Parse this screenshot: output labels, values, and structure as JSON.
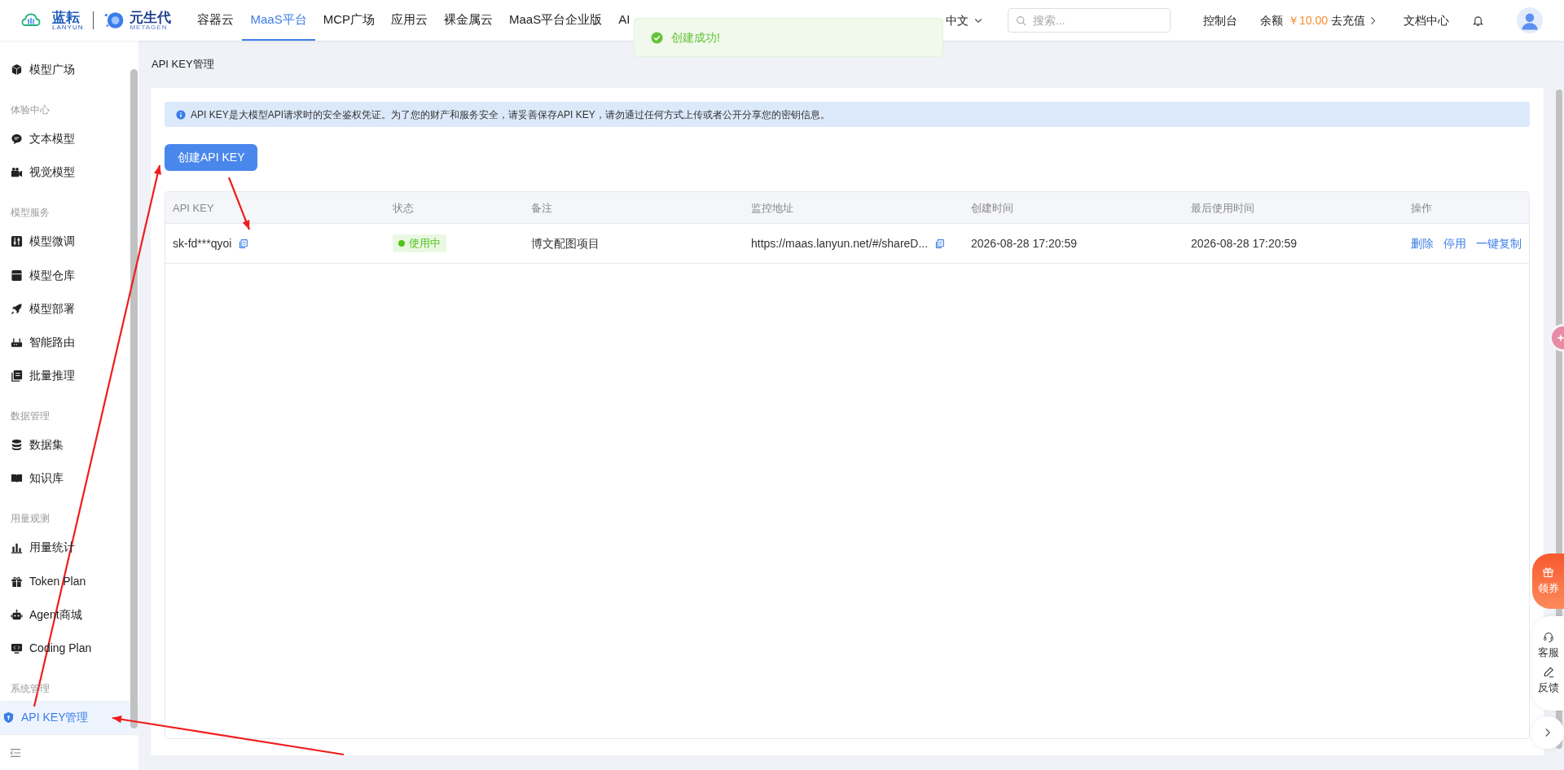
{
  "header": {
    "logo_brand": "蓝耘",
    "logo_sub": "LANYUN",
    "logo2_brand": "元生代",
    "logo2_sub": "METAGEN",
    "nav": [
      {
        "label": "容器云",
        "selected": false
      },
      {
        "label": "MaaS平台",
        "selected": true
      },
      {
        "label": "MCP广场",
        "selected": false
      },
      {
        "label": "应用云",
        "selected": false
      },
      {
        "label": "裸金属云",
        "selected": false
      },
      {
        "label": "MaaS平台企业版",
        "selected": false
      },
      {
        "label": "AI",
        "selected": false
      }
    ],
    "language": "中文",
    "search": {
      "placeholder": "搜索..."
    },
    "console": "控制台",
    "balance_label": "余额",
    "balance": "￥10.00",
    "recharge": "去充值",
    "docs": "文档中心"
  },
  "toast": {
    "message": "创建成功!"
  },
  "sidebar": {
    "groups": [
      {
        "items": [
          {
            "label": "模型广场",
            "selected": false
          }
        ]
      },
      {
        "title": "体验中心",
        "items": [
          {
            "label": "文本模型",
            "selected": false
          },
          {
            "label": "视觉模型",
            "selected": false
          }
        ]
      },
      {
        "title": "模型服务",
        "items": [
          {
            "label": "模型微调",
            "selected": false
          },
          {
            "label": "模型仓库",
            "selected": false
          },
          {
            "label": "模型部署",
            "selected": false
          },
          {
            "label": "智能路由",
            "selected": false
          },
          {
            "label": "批量推理",
            "selected": false
          }
        ]
      },
      {
        "title": "数据管理",
        "items": [
          {
            "label": "数据集",
            "selected": false
          },
          {
            "label": "知识库",
            "selected": false
          }
        ]
      },
      {
        "title": "用量观测",
        "items": [
          {
            "label": "用量统计",
            "selected": false
          },
          {
            "label": "Token Plan",
            "selected": false
          },
          {
            "label": "Agent商城",
            "selected": false
          },
          {
            "label": "Coding Plan",
            "selected": false
          }
        ]
      },
      {
        "title": "系统管理",
        "items": [
          {
            "label": "API KEY管理",
            "selected": true
          }
        ]
      }
    ]
  },
  "breadcrumb": "API KEY管理",
  "alert": "API KEY是大模型API请求时的安全鉴权凭证。为了您的财产和服务安全，请妥善保存API KEY，请勿通过任何方式上传或者公开分享您的密钥信息。",
  "create_button": "创建API KEY",
  "table": {
    "columns": [
      "API KEY",
      "状态",
      "备注",
      "监控地址",
      "创建时间",
      "最后使用时间",
      "操作"
    ],
    "rows": [
      {
        "key": "sk-fd***qyoi",
        "status": "使用中",
        "active": true,
        "note": "博文配图项目",
        "monitor_url": "https://maas.lanyun.net/#/shareD...",
        "created": "2026-08-28 17:20:59",
        "last_used": "2026-08-28 17:20:59",
        "actions": [
          "删除",
          "停用",
          "一键复制"
        ]
      }
    ]
  },
  "float": {
    "coupon": "领券",
    "service": "客服",
    "feedback": "反馈"
  }
}
